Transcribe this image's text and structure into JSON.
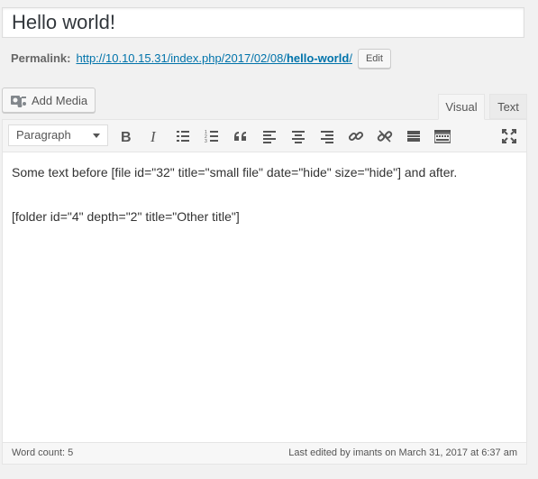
{
  "post": {
    "title": "Hello world!"
  },
  "permalink": {
    "label": "Permalink:",
    "url_base": "http://10.10.15.31/index.php/2017/02/08/",
    "slug": "hello-world",
    "url_trail": "/",
    "edit_label": "Edit"
  },
  "media": {
    "add_media_label": "Add Media"
  },
  "tabs": {
    "visual": "Visual",
    "text": "Text"
  },
  "toolbar": {
    "format_selected": "Paragraph",
    "icons": [
      "bold-icon",
      "italic-icon",
      "bulleted-list-icon",
      "numbered-list-icon",
      "blockquote-icon",
      "align-left-icon",
      "align-center-icon",
      "align-right-icon",
      "insert-link-icon",
      "remove-link-icon",
      "read-more-icon",
      "toolbar-toggle-icon",
      "fullscreen-icon"
    ]
  },
  "content": {
    "paragraphs": [
      "Some text before [file id=\"32\" title=\"small file\" date=\"hide\" size=\"hide\"] and after.",
      "[folder id=\"4\" depth=\"2\" title=\"Other title\"]"
    ]
  },
  "status": {
    "word_count": "Word count: 5",
    "last_edited": "Last edited by imants on March 31, 2017 at 6:37 am"
  },
  "colors": {
    "link": "#0073aa",
    "icon": "#555555"
  }
}
